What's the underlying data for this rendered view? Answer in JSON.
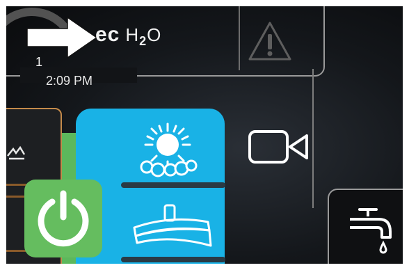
{
  "header": {
    "brand_ec": "ec",
    "brand_h2o_prefix": "H",
    "brand_h2o_sub": "2",
    "brand_h2o_suffix": "O",
    "gauge_value": "1",
    "time": "2:09 PM"
  },
  "icons": {
    "pointer": "arrow-icon",
    "warning": "warning-icon",
    "mode_clean": "sun-bubbles-icon",
    "squeegee": "squeegee-icon",
    "power": "power-icon",
    "camera": "camera-icon",
    "water": "faucet-icon",
    "brush": "brush-icon"
  },
  "colors": {
    "mode_panel": "#19b2e6",
    "power_button": "#65bd5f",
    "accent_border": "#c48a4a"
  }
}
